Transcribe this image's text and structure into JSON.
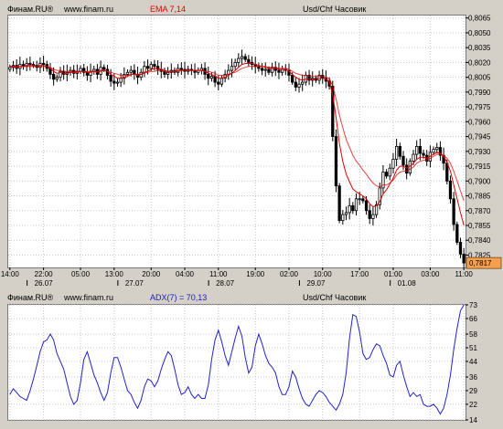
{
  "colors": {
    "candle": "#000000",
    "ema_fast": "#e00000",
    "ema_slow": "#e00000",
    "adx": "#2222cc",
    "last_price_bg": "#f5a050",
    "grid": "#c8c8c8"
  },
  "chart_data": [
    {
      "type": "candlestick",
      "header": {
        "source": "Финам.RU®",
        "site": "www.finam.ru",
        "indicator": "EMA 7,14",
        "symbol": "Usd/Chf Часовик"
      },
      "ylim": [
        0.78125,
        0.80675
      ],
      "y_ticks": [
        "0,8065",
        "0,8050",
        "0,8035",
        "0,8020",
        "0,8005",
        "0,7990",
        "0,7975",
        "0,7960",
        "0,7945",
        "0,7930",
        "0,7915",
        "0,7900",
        "0,7885",
        "0,7870",
        "0,7855",
        "0,7840",
        "0,7825"
      ],
      "last_price": "0,7817",
      "x_time_ticks": [
        "14:00",
        "22:00",
        "05:00",
        "13:00",
        "20:00",
        "04:00",
        "11:00",
        "19:00",
        "02:00",
        "10:00",
        "17:00",
        "01:00",
        "03:00",
        "11:00"
      ],
      "x_date_labels": [
        "26.07",
        "27.07",
        "28.07",
        "29.07",
        "01.08"
      ],
      "close": [
        0.8015,
        0.8017,
        0.8014,
        0.8018,
        0.8016,
        0.8019,
        0.8018,
        0.8017,
        0.8015,
        0.8019,
        0.8018,
        0.8014,
        0.8008,
        0.8003,
        0.8005,
        0.8011,
        0.8008,
        0.801,
        0.8012,
        0.8009,
        0.8011,
        0.8014,
        0.801,
        0.8007,
        0.8011,
        0.8013,
        0.8008,
        0.8015,
        0.8013,
        0.8007,
        0.8001,
        0.7999,
        0.8,
        0.8004,
        0.8008,
        0.801,
        0.8012,
        0.8008,
        0.8005,
        0.801,
        0.8016,
        0.8014,
        0.8018,
        0.8016,
        0.8013,
        0.8011,
        0.8008,
        0.801,
        0.8012,
        0.801,
        0.8014,
        0.8013,
        0.8011,
        0.8013,
        0.8012,
        0.801,
        0.8012,
        0.8014,
        0.8008,
        0.8004,
        0.8006,
        0.8,
        0.7998,
        0.8004,
        0.8008,
        0.8012,
        0.8016,
        0.802,
        0.8024,
        0.8026,
        0.8023,
        0.802,
        0.8018,
        0.8016,
        0.8014,
        0.8012,
        0.8013,
        0.801,
        0.8015,
        0.8012,
        0.801,
        0.8013,
        0.8012,
        0.8007,
        0.8,
        0.7995,
        0.7998,
        0.8,
        0.8007,
        0.8002,
        0.8004,
        0.8002,
        0.8007,
        0.8004,
        0.8001,
        0.7996,
        0.7945,
        0.7895,
        0.786,
        0.7866,
        0.7868,
        0.7875,
        0.787,
        0.7882,
        0.7882,
        0.788,
        0.787,
        0.7862,
        0.7866,
        0.7876,
        0.7893,
        0.7909,
        0.7905,
        0.7913,
        0.7922,
        0.7935,
        0.7925,
        0.7916,
        0.7908,
        0.792,
        0.7927,
        0.7935,
        0.7928,
        0.7926,
        0.792,
        0.7929,
        0.7932,
        0.7934,
        0.7926,
        0.7918,
        0.79,
        0.7882,
        0.7856,
        0.7838,
        0.7826,
        0.7817
      ],
      "ema_fast": [
        0.8016,
        0.8016,
        0.8015,
        0.8016,
        0.8016,
        0.8017,
        0.8017,
        0.8017,
        0.8016,
        0.8017,
        0.8017,
        0.8016,
        0.8014,
        0.8011,
        0.8009,
        0.801,
        0.8009,
        0.8009,
        0.801,
        0.801,
        0.801,
        0.8011,
        0.8011,
        0.801,
        0.801,
        0.8011,
        0.801,
        0.8012,
        0.8012,
        0.8011,
        0.8008,
        0.8006,
        0.8004,
        0.8004,
        0.8005,
        0.8006,
        0.8008,
        0.8008,
        0.8007,
        0.8008,
        0.801,
        0.8011,
        0.8013,
        0.8014,
        0.8014,
        0.8013,
        0.8012,
        0.8011,
        0.8011,
        0.8011,
        0.8012,
        0.8012,
        0.8012,
        0.8012,
        0.8012,
        0.8012,
        0.8012,
        0.8012,
        0.8011,
        0.8009,
        0.8008,
        0.8006,
        0.8004,
        0.8004,
        0.8005,
        0.8007,
        0.8009,
        0.8012,
        0.8015,
        0.8018,
        0.8019,
        0.8019,
        0.8019,
        0.8018,
        0.8017,
        0.8016,
        0.8015,
        0.8014,
        0.8014,
        0.8014,
        0.8013,
        0.8013,
        0.8013,
        0.8011,
        0.8008,
        0.8005,
        0.8003,
        0.8002,
        0.8003,
        0.8003,
        0.8003,
        0.8003,
        0.8004,
        0.8004,
        0.8003,
        0.8001,
        0.7987,
        0.7964,
        0.7938,
        0.792,
        0.7907,
        0.7899,
        0.7892,
        0.7889,
        0.7887,
        0.7885,
        0.7882,
        0.7877,
        0.7874,
        0.7875,
        0.7879,
        0.7887,
        0.7891,
        0.7897,
        0.7903,
        0.7911,
        0.7915,
        0.7915,
        0.7913,
        0.7915,
        0.7918,
        0.7922,
        0.7924,
        0.7924,
        0.7923,
        0.7925,
        0.7927,
        0.7929,
        0.7928,
        0.7925,
        0.7919,
        0.791,
        0.7896,
        0.7882,
        0.7868,
        0.7855
      ],
      "ema_slow": [
        0.8016,
        0.8016,
        0.8016,
        0.8016,
        0.8016,
        0.8016,
        0.8016,
        0.8016,
        0.8016,
        0.8016,
        0.8016,
        0.8016,
        0.8015,
        0.8013,
        0.8012,
        0.8012,
        0.8011,
        0.8011,
        0.8011,
        0.8011,
        0.8011,
        0.8011,
        0.8011,
        0.8011,
        0.8011,
        0.8011,
        0.8011,
        0.8011,
        0.8012,
        0.8011,
        0.801,
        0.8009,
        0.8008,
        0.8007,
        0.8007,
        0.8007,
        0.8008,
        0.8008,
        0.8008,
        0.8008,
        0.8009,
        0.801,
        0.8011,
        0.8011,
        0.8012,
        0.8012,
        0.8011,
        0.8011,
        0.8011,
        0.8011,
        0.8011,
        0.8012,
        0.8012,
        0.8012,
        0.8012,
        0.8012,
        0.8012,
        0.8012,
        0.8011,
        0.8011,
        0.801,
        0.8009,
        0.8007,
        0.8007,
        0.8007,
        0.8008,
        0.8009,
        0.801,
        0.8012,
        0.8014,
        0.8015,
        0.8016,
        0.8016,
        0.8016,
        0.8016,
        0.8016,
        0.8016,
        0.8015,
        0.8015,
        0.8015,
        0.8014,
        0.8014,
        0.8014,
        0.8013,
        0.8011,
        0.8009,
        0.8008,
        0.8007,
        0.8007,
        0.8006,
        0.8006,
        0.8006,
        0.8006,
        0.8006,
        0.8005,
        0.8004,
        0.7996,
        0.7983,
        0.7967,
        0.7954,
        0.7942,
        0.7934,
        0.7926,
        0.792,
        0.7916,
        0.7911,
        0.7907,
        0.7902,
        0.7898,
        0.7895,
        0.7894,
        0.7896,
        0.7896,
        0.7898,
        0.7901,
        0.7906,
        0.7909,
        0.791,
        0.791,
        0.7912,
        0.7914,
        0.7918,
        0.792,
        0.7921,
        0.7921,
        0.7923,
        0.7925,
        0.7927,
        0.7927,
        0.7926,
        0.7923,
        0.7918,
        0.791,
        0.79,
        0.789,
        0.788
      ]
    },
    {
      "type": "line",
      "header": {
        "source": "Финам.RU®",
        "site": "www.finam.ru",
        "indicator": "ADX(7) = 70,13",
        "symbol": "Usd/Chf Часовик"
      },
      "ylim": [
        14,
        73
      ],
      "y_ticks": [
        "73",
        "66",
        "58",
        "51",
        "44",
        "36",
        "29",
        "22",
        "14"
      ],
      "series": [
        {
          "name": "ADX(7)",
          "values": [
            27,
            30,
            28,
            26,
            25,
            24,
            29,
            35,
            42,
            49,
            54,
            55,
            58,
            55,
            48,
            44,
            40,
            33,
            26,
            22,
            24,
            33,
            45,
            49,
            43,
            37,
            33,
            28,
            24,
            28,
            38,
            46,
            46,
            41,
            35,
            29,
            27,
            23,
            20,
            24,
            31,
            35,
            34,
            31,
            34,
            40,
            45,
            49,
            47,
            40,
            32,
            27,
            28,
            31,
            27,
            25,
            27,
            25,
            25,
            32,
            45,
            55,
            60,
            54,
            47,
            42,
            49,
            56,
            62,
            57,
            46,
            38,
            41,
            52,
            58,
            53,
            47,
            43,
            41,
            38,
            31,
            27,
            27,
            31,
            39,
            36,
            30,
            25,
            22,
            21,
            24,
            27,
            29,
            28,
            26,
            23,
            21,
            19,
            22,
            27,
            38,
            56,
            68,
            67,
            59,
            48,
            45,
            46,
            50,
            53,
            52,
            47,
            43,
            37,
            36,
            42,
            44,
            37,
            31,
            26,
            28,
            26,
            27,
            22,
            21,
            21,
            22,
            20,
            17,
            20,
            27,
            37,
            50,
            61,
            70,
            73
          ]
        }
      ]
    }
  ]
}
